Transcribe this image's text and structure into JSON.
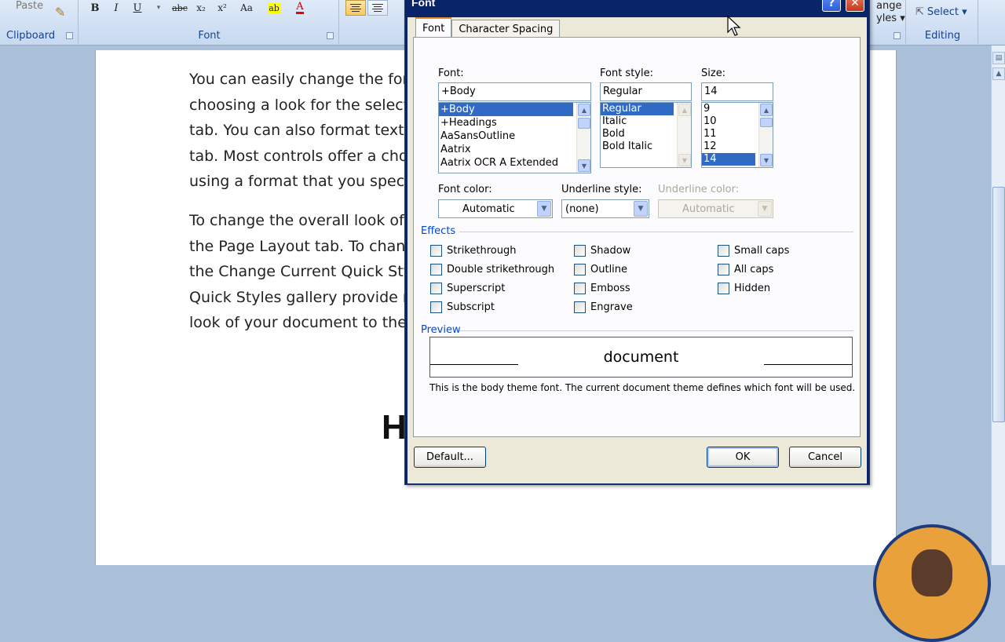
{
  "ribbon": {
    "paste": "Paste",
    "groups": {
      "clipboard": "Clipboard",
      "font": "Font",
      "editing": "Editing"
    },
    "format_buttons": {
      "bold": "B",
      "italic": "I",
      "underline": "U",
      "strike": "abc",
      "subscript": "x₂",
      "superscript": "x²",
      "case": "Aa",
      "highlight": "ab",
      "font_color": "A"
    },
    "change_styles_lines": [
      "ange",
      "yles ▾"
    ],
    "select_label": "Select ▾"
  },
  "document": {
    "para1": [
      "You can easily change the for",
      "choosing a look for the select",
      "tab. You can also format text",
      "tab. Most controls offer a cho",
      "using a format that you speci"
    ],
    "para2": [
      "To change the overall look of",
      "the Page Layout tab. To chan",
      "the Change Current Quick Sty",
      "Quick Styles gallery provide r",
      "look of your document to the"
    ],
    "heading_fragment": "H"
  },
  "dialog": {
    "title": "Font",
    "help": "?",
    "close": "✕",
    "tabs": [
      "Font",
      "Character Spacing"
    ],
    "font": {
      "label": "Font:",
      "value": "+Body",
      "items": [
        "+Body",
        "+Headings",
        "AaSansOutline",
        "Aatrix",
        "Aatrix OCR A Extended"
      ],
      "selected_index": 0
    },
    "style": {
      "label": "Font style:",
      "value": "Regular",
      "items": [
        "Regular",
        "Italic",
        "Bold",
        "Bold Italic"
      ],
      "selected_index": 0
    },
    "size": {
      "label": "Size:",
      "value": "14",
      "items": [
        "9",
        "10",
        "11",
        "12",
        "14"
      ],
      "selected_index": 4
    },
    "font_color": {
      "label": "Font color:",
      "value": "Automatic"
    },
    "underline_style": {
      "label": "Underline style:",
      "value": "(none)"
    },
    "underline_color": {
      "label": "Underline color:",
      "value": "Automatic"
    },
    "effects": {
      "label": "Effects",
      "items": [
        "Strikethrough",
        "Double strikethrough",
        "Superscript",
        "Subscript",
        "Shadow",
        "Outline",
        "Emboss",
        "Engrave",
        "Small caps",
        "All caps",
        "Hidden"
      ]
    },
    "preview": {
      "label": "Preview",
      "word": "document",
      "caption": "This is the body theme font. The current document theme defines which font will be used."
    },
    "buttons": {
      "default": "Default...",
      "ok": "OK",
      "cancel": "Cancel"
    }
  },
  "colors": {
    "title_bar": "#0a246a",
    "dialog_face": "#ece9d8",
    "selection": "#316ac5",
    "section_text": "#0046d5"
  }
}
